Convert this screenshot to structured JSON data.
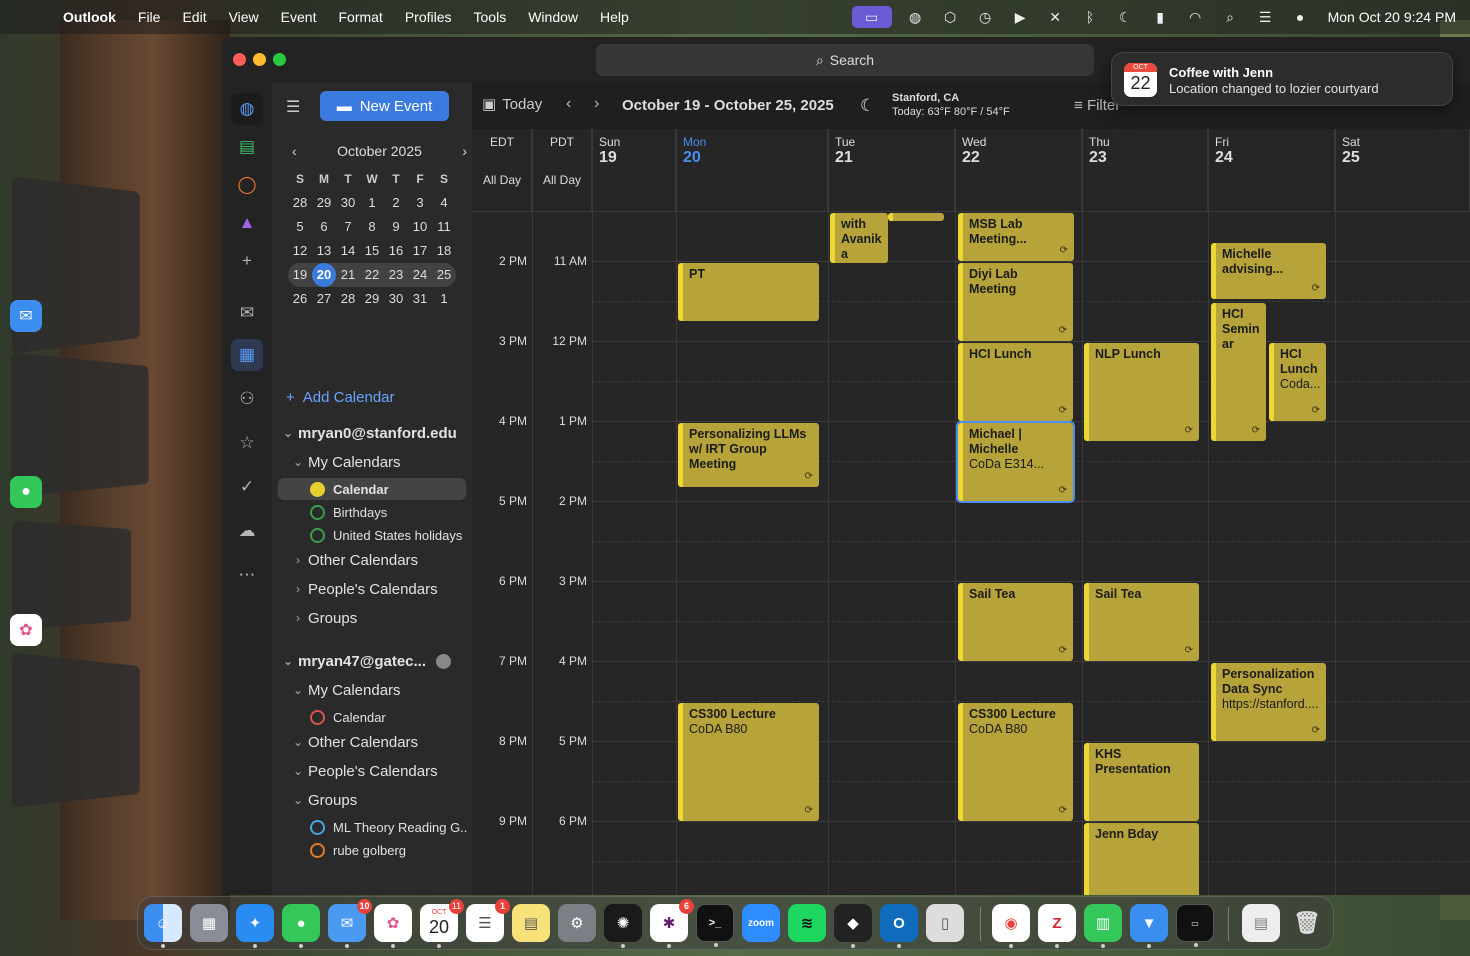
{
  "menubar": {
    "app": "Outlook",
    "items": [
      "File",
      "Edit",
      "View",
      "Event",
      "Format",
      "Profiles",
      "Tools",
      "Window",
      "Help"
    ],
    "clock": "Mon Oct 20  9:24 PM"
  },
  "search": {
    "label": "Search"
  },
  "sidebar": {
    "new_event": "New Event",
    "mini_month": "October 2025",
    "dow": [
      "S",
      "M",
      "T",
      "W",
      "T",
      "F",
      "S"
    ],
    "weeks": [
      [
        "28",
        "29",
        "30",
        "1",
        "2",
        "3",
        "4"
      ],
      [
        "5",
        "6",
        "7",
        "8",
        "9",
        "10",
        "11"
      ],
      [
        "12",
        "13",
        "14",
        "15",
        "16",
        "17",
        "18"
      ],
      [
        "19",
        "20",
        "21",
        "22",
        "23",
        "24",
        "25"
      ],
      [
        "26",
        "27",
        "28",
        "29",
        "30",
        "31",
        "1"
      ]
    ],
    "today": "20",
    "add_calendar": "Add Calendar",
    "account1": "mryan0@stanford.edu",
    "account2": "mryan47@gatec...",
    "my_calendars": "My Calendars",
    "other_calendars": "Other Calendars",
    "peoples_calendars": "People's Calendars",
    "groups": "Groups",
    "acc1_cals": [
      {
        "name": "Calendar",
        "color": "#e7cf2f"
      },
      {
        "name": "Birthdays",
        "color": "#3aa14a"
      },
      {
        "name": "United States holidays",
        "color": "#3aa14a"
      }
    ],
    "acc2_cals": [
      {
        "name": "Calendar",
        "color": "#d9534f"
      }
    ],
    "acc2_groups": [
      {
        "name": "ML Theory Reading G..",
        "color": "#4aa3e0"
      },
      {
        "name": "rube golberg",
        "color": "#e07b2a"
      }
    ]
  },
  "toolbar": {
    "today": "Today",
    "range": "October 19 - October 25, 2025",
    "location": "Stanford, CA",
    "weather": "Today: 63°F  80°F / 54°F",
    "filter": "Filter"
  },
  "grid": {
    "tz1": "EDT",
    "tz2": "PDT",
    "all_day": "All Day",
    "days": [
      {
        "name": "Sun",
        "num": "19"
      },
      {
        "name": "Mon",
        "num": "20"
      },
      {
        "name": "Tue",
        "num": "21"
      },
      {
        "name": "Wed",
        "num": "22"
      },
      {
        "name": "Thu",
        "num": "23"
      },
      {
        "name": "Fri",
        "num": "24"
      },
      {
        "name": "Sat",
        "num": "25"
      }
    ],
    "times_edt": [
      "2 PM",
      "3 PM",
      "4 PM",
      "5 PM",
      "6 PM",
      "7 PM",
      "8 PM",
      "9 PM"
    ],
    "times_pdt": [
      "11 AM",
      "12 PM",
      "1 PM",
      "2 PM",
      "3 PM",
      "4 PM",
      "5 PM",
      "6 PM"
    ]
  },
  "events": [
    {
      "title": "with Avanik a",
      "sub": ""
    },
    {
      "title": "MSB Lab Meeting...",
      "sub": ""
    },
    {
      "title": "PT",
      "sub": ""
    },
    {
      "title": "Diyi Lab Meeting",
      "sub": ""
    },
    {
      "title": "Michelle advising...",
      "sub": ""
    },
    {
      "title": "HCI Semin ar",
      "sub": ""
    },
    {
      "title": "HCI Lunch",
      "sub": ""
    },
    {
      "title": "NLP Lunch",
      "sub": ""
    },
    {
      "title": "HCI Lunch",
      "sub": "Coda..."
    },
    {
      "title": "Personalizing LLMs w/ IRT Group Meeting",
      "sub": ""
    },
    {
      "title": "Michael | Michelle",
      "sub": "CoDa E314..."
    },
    {
      "title": "Sail Tea",
      "sub": ""
    },
    {
      "title": "Sail Tea",
      "sub": ""
    },
    {
      "title": "Personalization Data Sync",
      "sub": "https://stanford...."
    },
    {
      "title": "CS300 Lecture",
      "sub": "CoDA B80"
    },
    {
      "title": "CS300 Lecture",
      "sub": "CoDA B80"
    },
    {
      "title": "KHS Presentation",
      "sub": ""
    },
    {
      "title": "Jenn Bday",
      "sub": ""
    }
  ],
  "notification": {
    "month": "OCT",
    "day": "22",
    "title": "Coffee with Jenn",
    "body": "Location changed to lozier courtyard"
  },
  "dock": {
    "badges": {
      "mail": "10",
      "calendar": "11",
      "reminders": "1",
      "slack": "6"
    },
    "calendar_month": "OCT",
    "calendar_day": "20",
    "zoom": "zoom"
  }
}
